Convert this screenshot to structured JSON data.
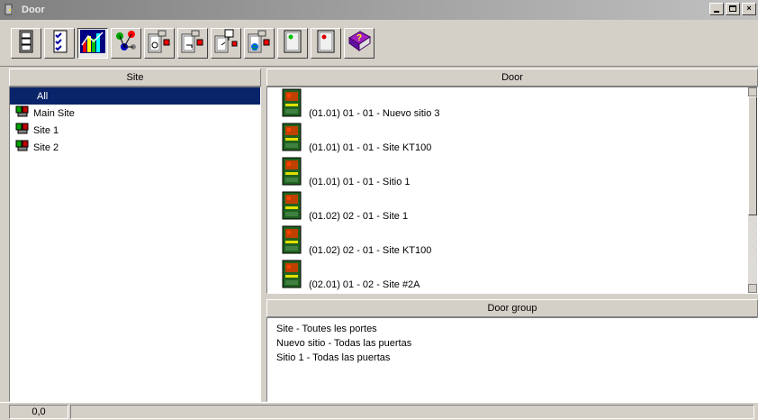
{
  "window": {
    "title": "Door"
  },
  "toolbar": {
    "buttons": [
      {
        "icon": "cabinet-icon"
      },
      {
        "icon": "checklist-icon"
      },
      {
        "icon": "bar-chart-icon"
      },
      {
        "icon": "network-icon"
      },
      {
        "icon": "door-lock-icon"
      },
      {
        "icon": "door-key-icon"
      },
      {
        "icon": "door-tree-icon"
      },
      {
        "icon": "door-globe-icon"
      },
      {
        "icon": "panel-green-icon"
      },
      {
        "icon": "panel-red-icon"
      },
      {
        "icon": "help-book-icon"
      }
    ]
  },
  "site_panel": {
    "header": "Site",
    "items": [
      {
        "label": "All",
        "selected": true
      },
      {
        "label": "Main Site"
      },
      {
        "label": "Site 1"
      },
      {
        "label": "Site 2"
      }
    ]
  },
  "door_panel": {
    "header": "Door",
    "items": [
      {
        "label": "(01.01) 01 - 01 - Nuevo sitio 3"
      },
      {
        "label": "(01.01) 01 - 01 - Site KT100"
      },
      {
        "label": "(01.01) 01 - 01 - Sitio 1"
      },
      {
        "label": "(01.02) 02 - 01 - Site 1"
      },
      {
        "label": "(01.02) 02 - 01 - Site KT100"
      },
      {
        "label": "(02.01) 01 - 02 - Site #2A"
      }
    ]
  },
  "door_group_panel": {
    "header": "Door group",
    "items": [
      {
        "label": "Site - Toutes les portes"
      },
      {
        "label": "Nuevo sitio - Todas las puertas"
      },
      {
        "label": "Sitio 1 - Todas las puertas"
      }
    ]
  },
  "status": {
    "coords": "0,0"
  },
  "colors": {
    "selection": "#0a246a",
    "chrome": "#d4d0c8"
  }
}
